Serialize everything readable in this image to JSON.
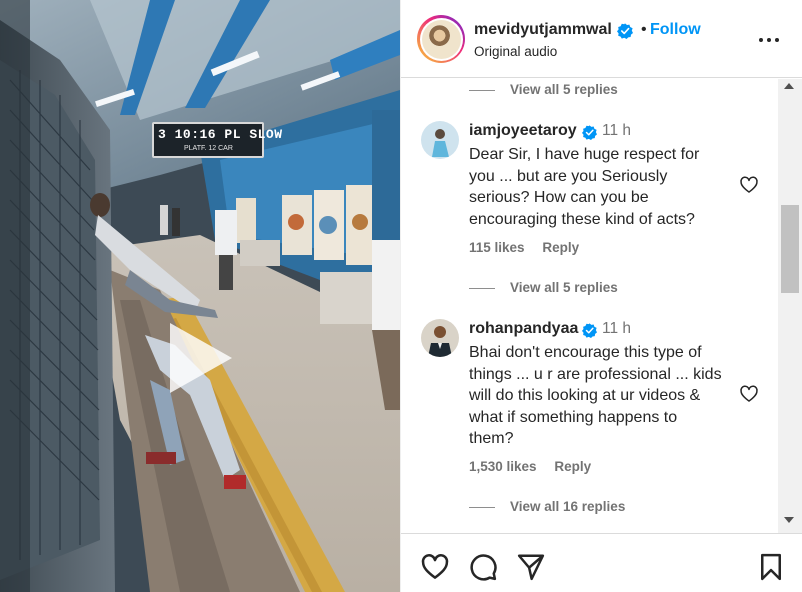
{
  "post": {
    "username": "mevidyutjammwal",
    "follow_label": "Follow",
    "follow_separator": "•",
    "audio": "Original audio",
    "verified": true
  },
  "video": {
    "sign_line1": "3 10:16 PL SLOW",
    "sign_line2": "PLATF.        12 CAR"
  },
  "comments": [
    {
      "type": "view_replies",
      "label": "View all 5 replies"
    },
    {
      "type": "comment",
      "username": "iamjoyeetaroy",
      "verified": true,
      "time": "11 h",
      "lines": [
        "Dear Sir, I have huge respect for",
        "you ... but are you Seriously",
        "serious? How can you be",
        "encouraging these kind of acts?"
      ],
      "likes": "115 likes",
      "reply_label": "Reply"
    },
    {
      "type": "view_replies",
      "label": "View all 5 replies"
    },
    {
      "type": "comment",
      "username": "rohanpandyaa",
      "verified": true,
      "time": "11 h",
      "lines": [
        "Bhai don't encourage this type of",
        "things ... u r are professional ... kids",
        "will do this looking at ur videos &",
        "what if something happens to",
        "them?"
      ],
      "likes": "1,530 likes",
      "reply_label": "Reply"
    },
    {
      "type": "view_replies",
      "label": "View all 16 replies"
    }
  ],
  "colors": {
    "link_blue": "#0095f6",
    "verified_blue": "#0095f6",
    "muted": "#737373",
    "text": "#262626"
  },
  "icons": [
    "more-icon",
    "verified-icon",
    "heart-icon",
    "comment-icon",
    "share-icon",
    "bookmark-icon",
    "play-icon"
  ]
}
